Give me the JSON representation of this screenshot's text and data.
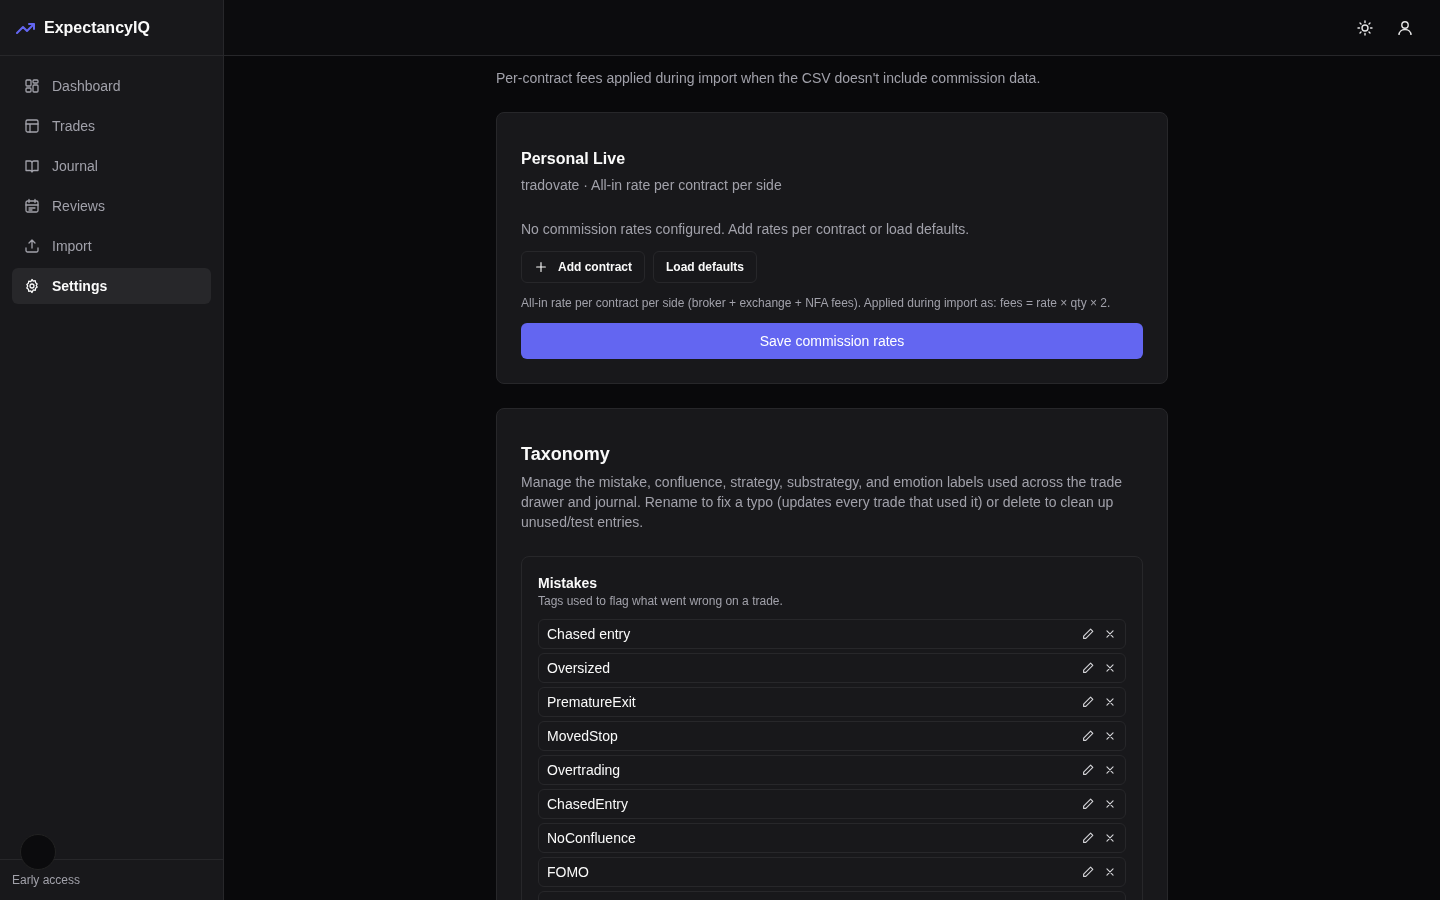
{
  "app": {
    "name": "ExpectancyIQ"
  },
  "sidebar": {
    "items": [
      {
        "label": "Dashboard",
        "selected": false
      },
      {
        "label": "Trades",
        "selected": false
      },
      {
        "label": "Journal",
        "selected": false
      },
      {
        "label": "Reviews",
        "selected": false
      },
      {
        "label": "Import",
        "selected": false
      },
      {
        "label": "Settings",
        "selected": true
      }
    ],
    "footer": "Early access"
  },
  "section": {
    "subtitle": "Per-contract fees applied during import when the CSV doesn't include commission data."
  },
  "account_card": {
    "title": "Personal Live",
    "subtitle": "tradovate · All-in rate per contract per side",
    "empty_text": "No commission rates configured. Add rates per contract or load defaults.",
    "buttons": [
      {
        "label": "Add contract"
      },
      {
        "label": "Load defaults"
      }
    ],
    "note": "All-in rate per contract per side (broker + exchange + NFA fees). Applied during import as: fees = rate × qty × 2.",
    "save_button": "Save commission rates"
  },
  "taxonomy": {
    "title": "Taxonomy",
    "description": "Manage the mistake, confluence, strategy, substrategy, and emotion labels used across the trade drawer and journal. Rename to fix a typo (updates every trade that used it) or delete to clean up unused/test entries.",
    "groups": [
      {
        "title": "Mistakes",
        "subtitle": "Tags used to flag what went wrong on a trade.",
        "tags": [
          "Chased entry",
          "Oversized",
          "PrematureExit",
          "MovedStop",
          "Overtrading",
          "ChasedEntry",
          "NoConfluence",
          "FOMO"
        ]
      }
    ]
  }
}
